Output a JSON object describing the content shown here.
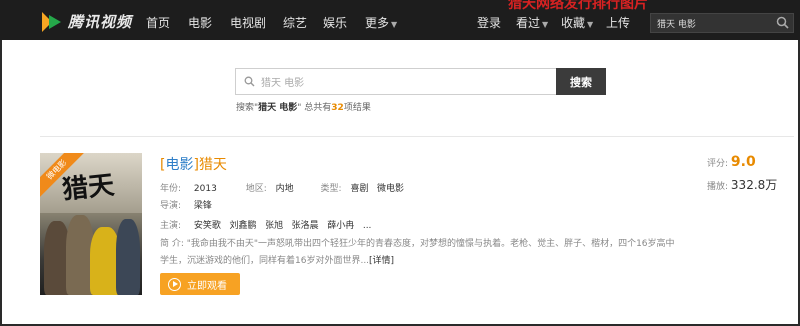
{
  "header": {
    "logo_text": "腾讯视频",
    "nav": [
      "首页",
      "电影",
      "电视剧",
      "综艺",
      "娱乐",
      "更多"
    ],
    "user_links": [
      "登录",
      "看过",
      "收藏",
      "上传"
    ],
    "promo_text": "猎天网络发行排行图片",
    "search_value": "猎天 电影"
  },
  "search": {
    "placeholder": "猎天 电影",
    "button": "搜索",
    "summary_prefix": "搜索\"",
    "summary_query": "猎天 电影",
    "summary_mid": "\" 总共有",
    "summary_count": "32",
    "summary_suffix": "项结果"
  },
  "result": {
    "ribbon": "微电影",
    "poster_title": "猎天",
    "title_category": "电影",
    "title_name": "猎天",
    "year_label": "年份:",
    "year": "2013",
    "region_label": "地区:",
    "region": "内地",
    "genre_label": "类型:",
    "genres": "喜剧   微电影",
    "director_label": "导演:",
    "director": "梁锋",
    "cast_label": "主演:",
    "cast": "安笑歌   刘鑫鹏   张旭   张洛晨   薛小冉   ...",
    "summary_label": "简 介:",
    "summary": "\"我命由我不由天\"一声怒吼带出四个轻狂少年的青春态度，对梦想的憧憬与执着。老枪、觉主、胖子、楷材，四个16岁高中学生，沉迷游戏的他们，同样有着16岁对外面世界...",
    "more": "[详情]",
    "watch_button": "立即观看",
    "score_label": "评分:",
    "score": "9.0",
    "plays_label": "播放:",
    "plays": "332.8",
    "plays_unit": "万"
  },
  "colors": {
    "accent": "#e88a00",
    "nav_bg": "#1d1d1d",
    "watch_btn": "#f7a223",
    "category": "#2f7fc8"
  }
}
